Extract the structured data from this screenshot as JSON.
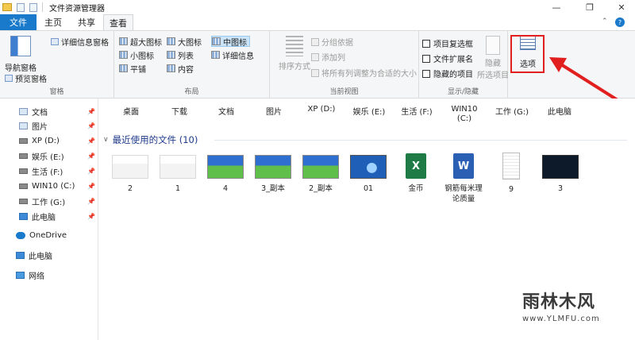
{
  "window": {
    "title": "文件资源管理器"
  },
  "tabs": [
    {
      "label": "文件"
    },
    {
      "label": "主页"
    },
    {
      "label": "共享"
    },
    {
      "label": "查看"
    }
  ],
  "ribbon": {
    "pane": {
      "nav_pane": "导航窗格",
      "preview_pane": "预览窗格",
      "details_pane": "详细信息窗格",
      "group_label": "窗格"
    },
    "layout": {
      "items": [
        "超大图标",
        "大图标",
        "中图标",
        "小图标",
        "列表",
        "详细信息",
        "平铺",
        "内容"
      ],
      "selected": "中图标",
      "group_label": "布局"
    },
    "current_view": {
      "sort_by": "排序方式",
      "group_by": "分组依据",
      "add_columns": "添加列",
      "fit_columns": "将所有列调整为合适的大小",
      "group_label": "当前视图"
    },
    "show_hide": {
      "item_checkboxes": "项目复选框",
      "file_extensions": "文件扩展名",
      "hidden_items": "隐藏的项目",
      "hide_selected": [
        "隐藏",
        "所选项目"
      ],
      "group_label": "显示/隐藏"
    },
    "options": {
      "label": "选项"
    }
  },
  "annotation": {
    "highlight_color": "#e21f1f"
  },
  "nav": {
    "items": [
      {
        "label": "文档",
        "pinned": true
      },
      {
        "label": "图片",
        "pinned": true
      },
      {
        "label": "XP (D:)",
        "pinned": true
      },
      {
        "label": "娱乐 (E:)",
        "pinned": true
      },
      {
        "label": "生活 (F:)",
        "pinned": true
      },
      {
        "label": "WIN10 (C:)",
        "pinned": true
      },
      {
        "label": "工作 (G:)",
        "pinned": true
      },
      {
        "label": "此电脑",
        "pinned": true
      },
      {
        "label": "OneDrive",
        "pinned": false
      },
      {
        "label": "此电脑",
        "pinned": false
      },
      {
        "label": "网络",
        "pinned": false
      }
    ],
    "pin_glyph": "📌"
  },
  "frequent_folders": [
    "桌面",
    "下载",
    "文档",
    "图片",
    "XP (D:)",
    "娱乐 (E:)",
    "生活 (F:)",
    "WIN10",
    "(C:)",
    "工作 (G:)",
    "此电脑"
  ],
  "recent": {
    "title": "最近使用的文件 (10)",
    "files": [
      {
        "name": "2",
        "kind": "doc"
      },
      {
        "name": "1",
        "kind": "doc"
      },
      {
        "name": "4",
        "kind": "land"
      },
      {
        "name": "3_副本",
        "kind": "land"
      },
      {
        "name": "2_副本",
        "kind": "land"
      },
      {
        "name": "01",
        "kind": "win7"
      },
      {
        "name": "金币",
        "kind": "excel"
      },
      {
        "name": "钢筋每米理论质量",
        "kind": "word"
      },
      {
        "name": "9",
        "kind": "paper"
      },
      {
        "name": "3",
        "kind": "dark"
      }
    ]
  },
  "watermark": {
    "title": "雨林木风",
    "url": "www.YLMFU.com"
  }
}
